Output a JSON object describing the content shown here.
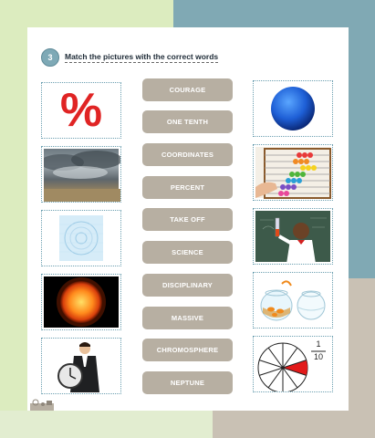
{
  "exercise": {
    "number": "3",
    "instruction": "Match the pictures with the correct words"
  },
  "words": [
    "COURAGE",
    "ONE TENTH",
    "COORDINATES",
    "PERCENT",
    "TAKE OFF",
    "SCIENCE",
    "DISCIPLINARY",
    "MASSIVE",
    "CHROMOSPHERE",
    "NEPTUNE"
  ],
  "left_pictures": [
    {
      "icon": "percent-sign"
    },
    {
      "icon": "storm-clouds"
    },
    {
      "icon": "blue-pattern"
    },
    {
      "icon": "sun"
    },
    {
      "icon": "man-with-clock"
    }
  ],
  "right_pictures": [
    {
      "icon": "planet-neptune"
    },
    {
      "icon": "abacus"
    },
    {
      "icon": "boy-science-experiment"
    },
    {
      "icon": "fish-bowls"
    },
    {
      "icon": "fraction-circle"
    }
  ],
  "percent_symbol": "%",
  "fraction": {
    "numerator": "1",
    "denominator": "10"
  },
  "colors": {
    "teal": "#80a9b6",
    "word_button": "#b7afa2",
    "percent_red": "#e02424",
    "fraction_red": "#e21a1a"
  }
}
